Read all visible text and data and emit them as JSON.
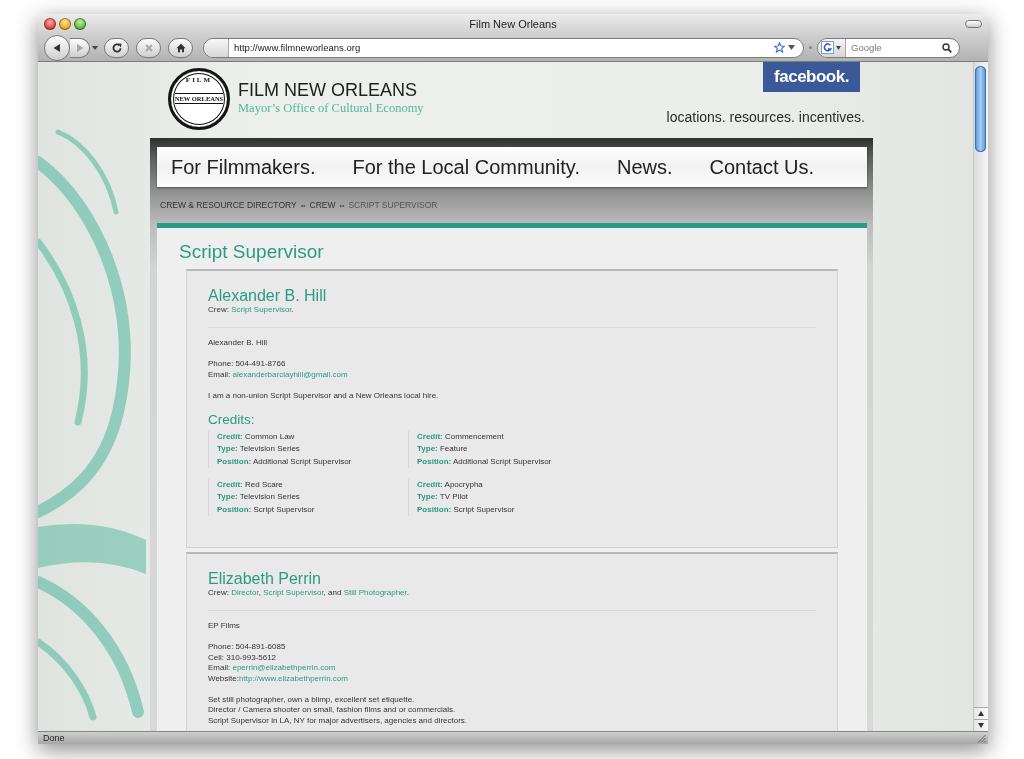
{
  "window": {
    "title": "Film New Orleans"
  },
  "toolbar": {
    "buttons": [
      {
        "kind": "back",
        "disabled": false
      },
      {
        "kind": "forward",
        "disabled": true
      },
      {
        "kind": "reload",
        "disabled": false
      },
      {
        "kind": "stop",
        "disabled": true
      },
      {
        "kind": "home",
        "disabled": false
      }
    ],
    "url": "http://www.filmneworleans.org",
    "search": {
      "placeholder": "Google"
    }
  },
  "header": {
    "logo": {
      "top": "FILM",
      "band": "NEW ORLEANS"
    },
    "title": "FILM NEW ORLEANS",
    "subtitle": "Mayor’s Office of Cultural Economy",
    "facebook": "facebook.",
    "tagline": "locations. resources. incentives."
  },
  "nav": [
    {
      "label": "For Filmmakers."
    },
    {
      "label": "For the Local Community."
    },
    {
      "label": "News."
    },
    {
      "label": "Contact Us."
    }
  ],
  "breadcrumb": {
    "items": [
      {
        "label": "CREW & RESOURCE DIRECTORY",
        "current": false,
        "separator": "••"
      },
      {
        "label": "CREW",
        "current": false,
        "separator": "••"
      },
      {
        "label": "SCRIPT SUPERVISOR",
        "current": true
      }
    ]
  },
  "page_title": "Script Supervisor",
  "profiles": [
    {
      "name": "Alexander B. Hill",
      "crew": [
        {
          "kind": "text",
          "text": "Crew: "
        },
        {
          "kind": "link",
          "text": "Script Supervisor"
        },
        {
          "kind": "text",
          "text": "."
        }
      ],
      "blocks": [
        {
          "lines": [
            {
              "parts": [
                {
                  "kind": "text",
                  "text": "Alexander B. Hill"
                }
              ]
            }
          ]
        },
        {
          "lines": [
            {
              "parts": [
                {
                  "kind": "text",
                  "text": "Phone: 504-491-8766"
                }
              ]
            },
            {
              "parts": [
                {
                  "kind": "text",
                  "text": "Email: "
                },
                {
                  "kind": "link",
                  "text": "alexanderbarclayhill@gmail.com"
                }
              ]
            }
          ]
        },
        {
          "lines": [
            {
              "parts": [
                {
                  "kind": "text",
                  "text": "I am a non-union Script Supervisor and a New Orleans local hire."
                }
              ]
            }
          ]
        }
      ],
      "credits": {
        "title": "Credits:",
        "items": [
          {
            "fields": [
              {
                "label": "Credit:",
                "value": "Common Law"
              },
              {
                "label": "Type:",
                "value": "Television Series"
              },
              {
                "label": "Position:",
                "value": "Additional Script Supervisor"
              }
            ]
          },
          {
            "fields": [
              {
                "label": "Credit:",
                "value": "Commencement"
              },
              {
                "label": "Type:",
                "value": "Feature"
              },
              {
                "label": "Position:",
                "value": "Additional Script Supervisor"
              }
            ]
          },
          {
            "fields": [
              {
                "label": "Credit:",
                "value": "Red Scare"
              },
              {
                "label": "Type:",
                "value": "Television Series"
              },
              {
                "label": "Position:",
                "value": "Script Supervisor"
              }
            ]
          },
          {
            "fields": [
              {
                "label": "Credit:",
                "value": "Apocrypha"
              },
              {
                "label": "Type:",
                "value": "TV Pilot"
              },
              {
                "label": "Position:",
                "value": "Script Supervisor"
              }
            ]
          }
        ]
      }
    },
    {
      "name": "Elizabeth Perrin",
      "crew": [
        {
          "kind": "text",
          "text": "Crew: "
        },
        {
          "kind": "link",
          "text": "Director"
        },
        {
          "kind": "text",
          "text": ", "
        },
        {
          "kind": "link",
          "text": "Script Supervisor"
        },
        {
          "kind": "text",
          "text": ", and "
        },
        {
          "kind": "link",
          "text": "Still Photographer"
        },
        {
          "kind": "text",
          "text": "."
        }
      ],
      "blocks": [
        {
          "lines": [
            {
              "parts": [
                {
                  "kind": "text",
                  "text": "EP Films"
                }
              ]
            }
          ]
        },
        {
          "lines": [
            {
              "parts": [
                {
                  "kind": "text",
                  "text": "Phone: 504-891-6085"
                }
              ]
            },
            {
              "parts": [
                {
                  "kind": "text",
                  "text": "Cell: 310-993-5612"
                }
              ]
            },
            {
              "parts": [
                {
                  "kind": "text",
                  "text": "Email: "
                },
                {
                  "kind": "link",
                  "text": "eperrin@elizabethperrin.com"
                }
              ]
            },
            {
              "parts": [
                {
                  "kind": "text",
                  "text": "Website:"
                },
                {
                  "kind": "link",
                  "text": "http://www.elizabethperrin.com"
                }
              ]
            }
          ]
        },
        {
          "lines": [
            {
              "parts": [
                {
                  "kind": "text",
                  "text": "Set still photographer, own a blimp, excellent set etiquette."
                }
              ]
            },
            {
              "parts": [
                {
                  "kind": "text",
                  "text": "Director / Camera shooter on small, fashion films and or commercials."
                }
              ]
            },
            {
              "parts": [
                {
                  "kind": "text",
                  "text": "Script Supervisor in LA, NY for major advertisers, agencies and directors."
                }
              ]
            }
          ]
        }
      ]
    }
  ],
  "status_bar": {
    "text": "Done"
  }
}
